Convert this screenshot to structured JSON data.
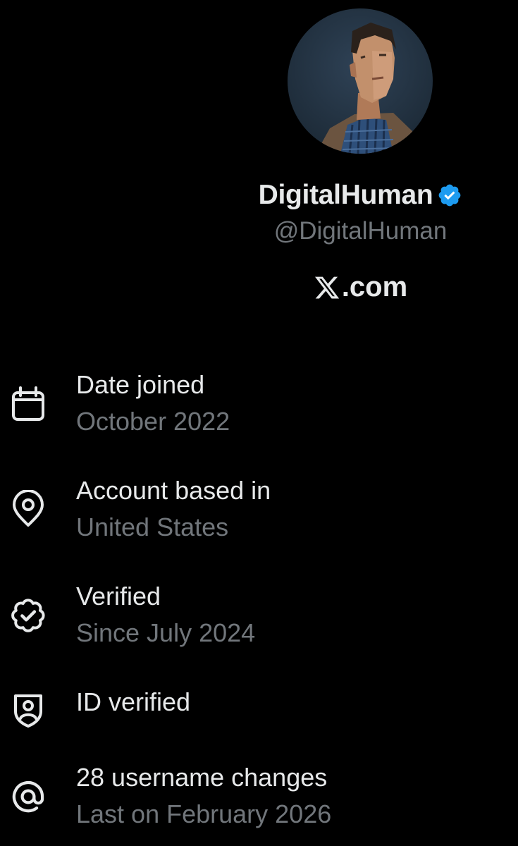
{
  "profile": {
    "display_name": "DigitalHuman",
    "handle": "@DigitalHuman",
    "verified": true,
    "website": ".com",
    "website_logo": "x-logo"
  },
  "colors": {
    "background": "#000000",
    "primary_text": "#e7e9ea",
    "secondary_text": "#71767b",
    "verified_blue": "#1d9bf0"
  },
  "about": {
    "items": [
      {
        "icon": "calendar-icon",
        "title": "Date joined",
        "subtitle": "October 2022"
      },
      {
        "icon": "location-pin-icon",
        "title": "Account based in",
        "subtitle": "United States"
      },
      {
        "icon": "verified-badge-icon",
        "title": "Verified",
        "subtitle": "Since July 2024"
      },
      {
        "icon": "id-shield-icon",
        "title": "ID verified",
        "subtitle": ""
      },
      {
        "icon": "at-sign-icon",
        "title": "28 username changes",
        "subtitle": "Last on February 2026"
      }
    ]
  }
}
